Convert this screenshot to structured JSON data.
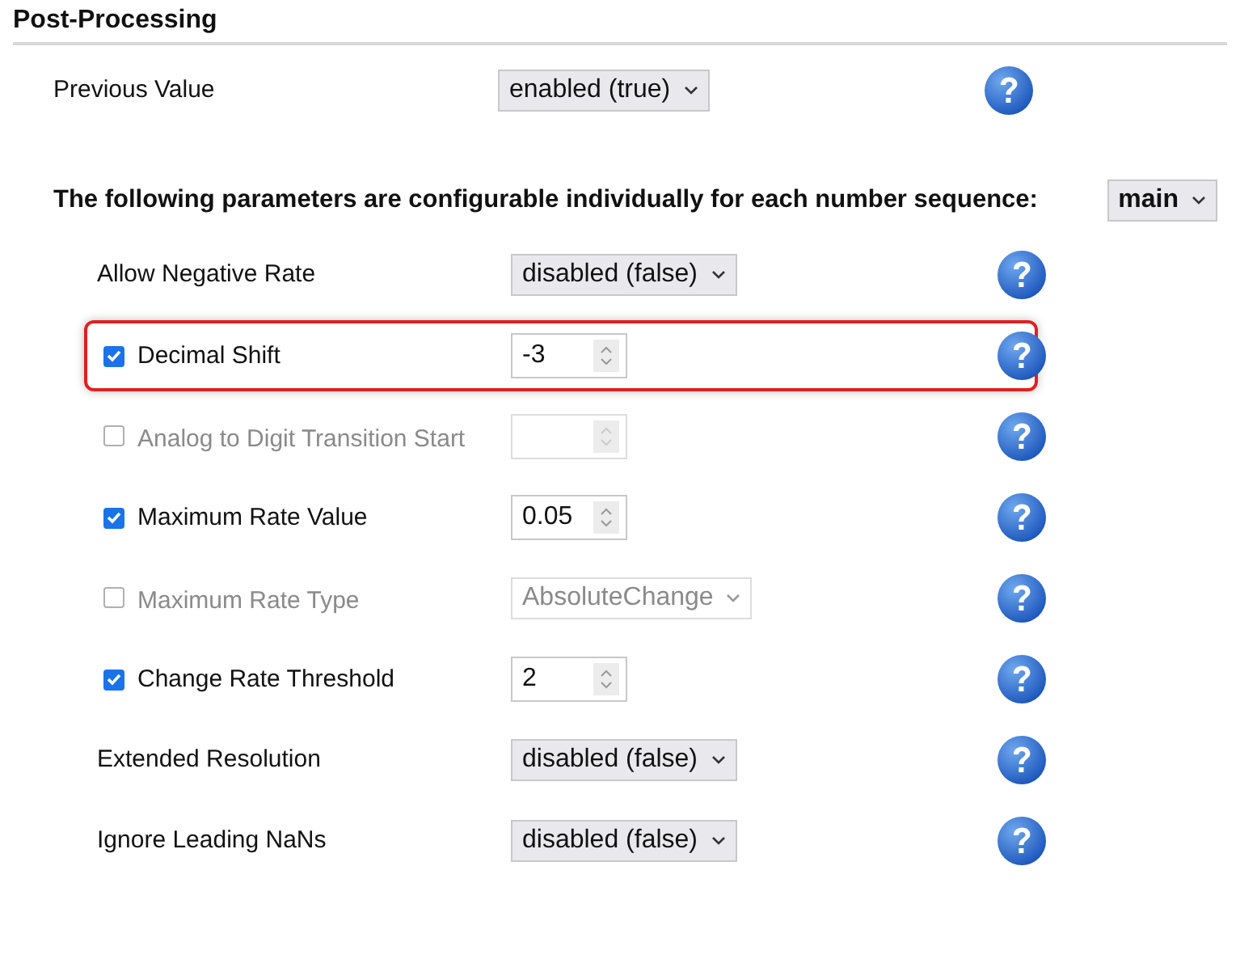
{
  "section": {
    "title": "Post-Processing"
  },
  "global_row": {
    "label": "Previous Value",
    "kind": "select",
    "value": "enabled (true)"
  },
  "sequence_prompt": {
    "text": "The following parameters are configurable individually for each number sequence:",
    "value": "main"
  },
  "parameters": [
    {
      "label": "Allow Negative Rate",
      "kind": "select",
      "value": "disabled (false)",
      "disabled": false,
      "highlighted": false
    },
    {
      "label": "Decimal Shift",
      "kind": "number",
      "value": "-3",
      "checked": true,
      "disabled": false,
      "highlighted": true
    },
    {
      "label": "Analog to Digit Transition Start",
      "kind": "number",
      "checked": false,
      "disabled": true,
      "highlighted": false
    },
    {
      "label": "Maximum Rate Value",
      "kind": "number",
      "value": "0.05",
      "checked": true,
      "disabled": false,
      "highlighted": false
    },
    {
      "label": "Maximum Rate Type",
      "kind": "select",
      "value": "AbsoluteChange",
      "checked": false,
      "disabled": true,
      "highlighted": false
    },
    {
      "label": "Change Rate Threshold",
      "kind": "number",
      "value": "2",
      "checked": true,
      "disabled": false,
      "highlighted": false
    },
    {
      "label": "Extended Resolution",
      "kind": "select",
      "value": "disabled (false)",
      "disabled": false,
      "highlighted": false
    },
    {
      "label": "Ignore Leading NaNs",
      "kind": "select",
      "value": "disabled (false)",
      "disabled": false,
      "highlighted": false
    }
  ]
}
